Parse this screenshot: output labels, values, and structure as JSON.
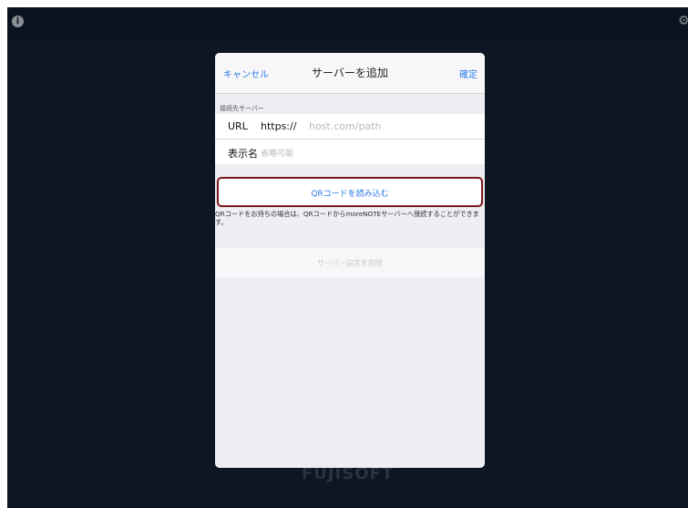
{
  "app": {
    "brand": "FUJISOFT"
  },
  "icons": {
    "info": "info-icon",
    "settings": "gear-icon"
  },
  "modal": {
    "nav": {
      "cancel_label": "キャンセル",
      "title": "サーバーを追加",
      "confirm_label": "確定"
    },
    "section_header": "接続先サーバー",
    "url_field": {
      "label": "URL",
      "scheme": "https://",
      "placeholder": "host.com/path"
    },
    "display_name_field": {
      "label": "表示名",
      "placeholder": "省略可能"
    },
    "qr_button_label": "QRコードを読み込む",
    "qr_note": "QRコードをお持ちの場合は、QRコードからmoreNOTEサーバーへ接続することができます。",
    "delete_label": "サーバー設定を削除"
  },
  "colors": {
    "accent": "#2a7be8",
    "highlight_border": "#7d1b1b",
    "background_dark": "#0d1623"
  }
}
